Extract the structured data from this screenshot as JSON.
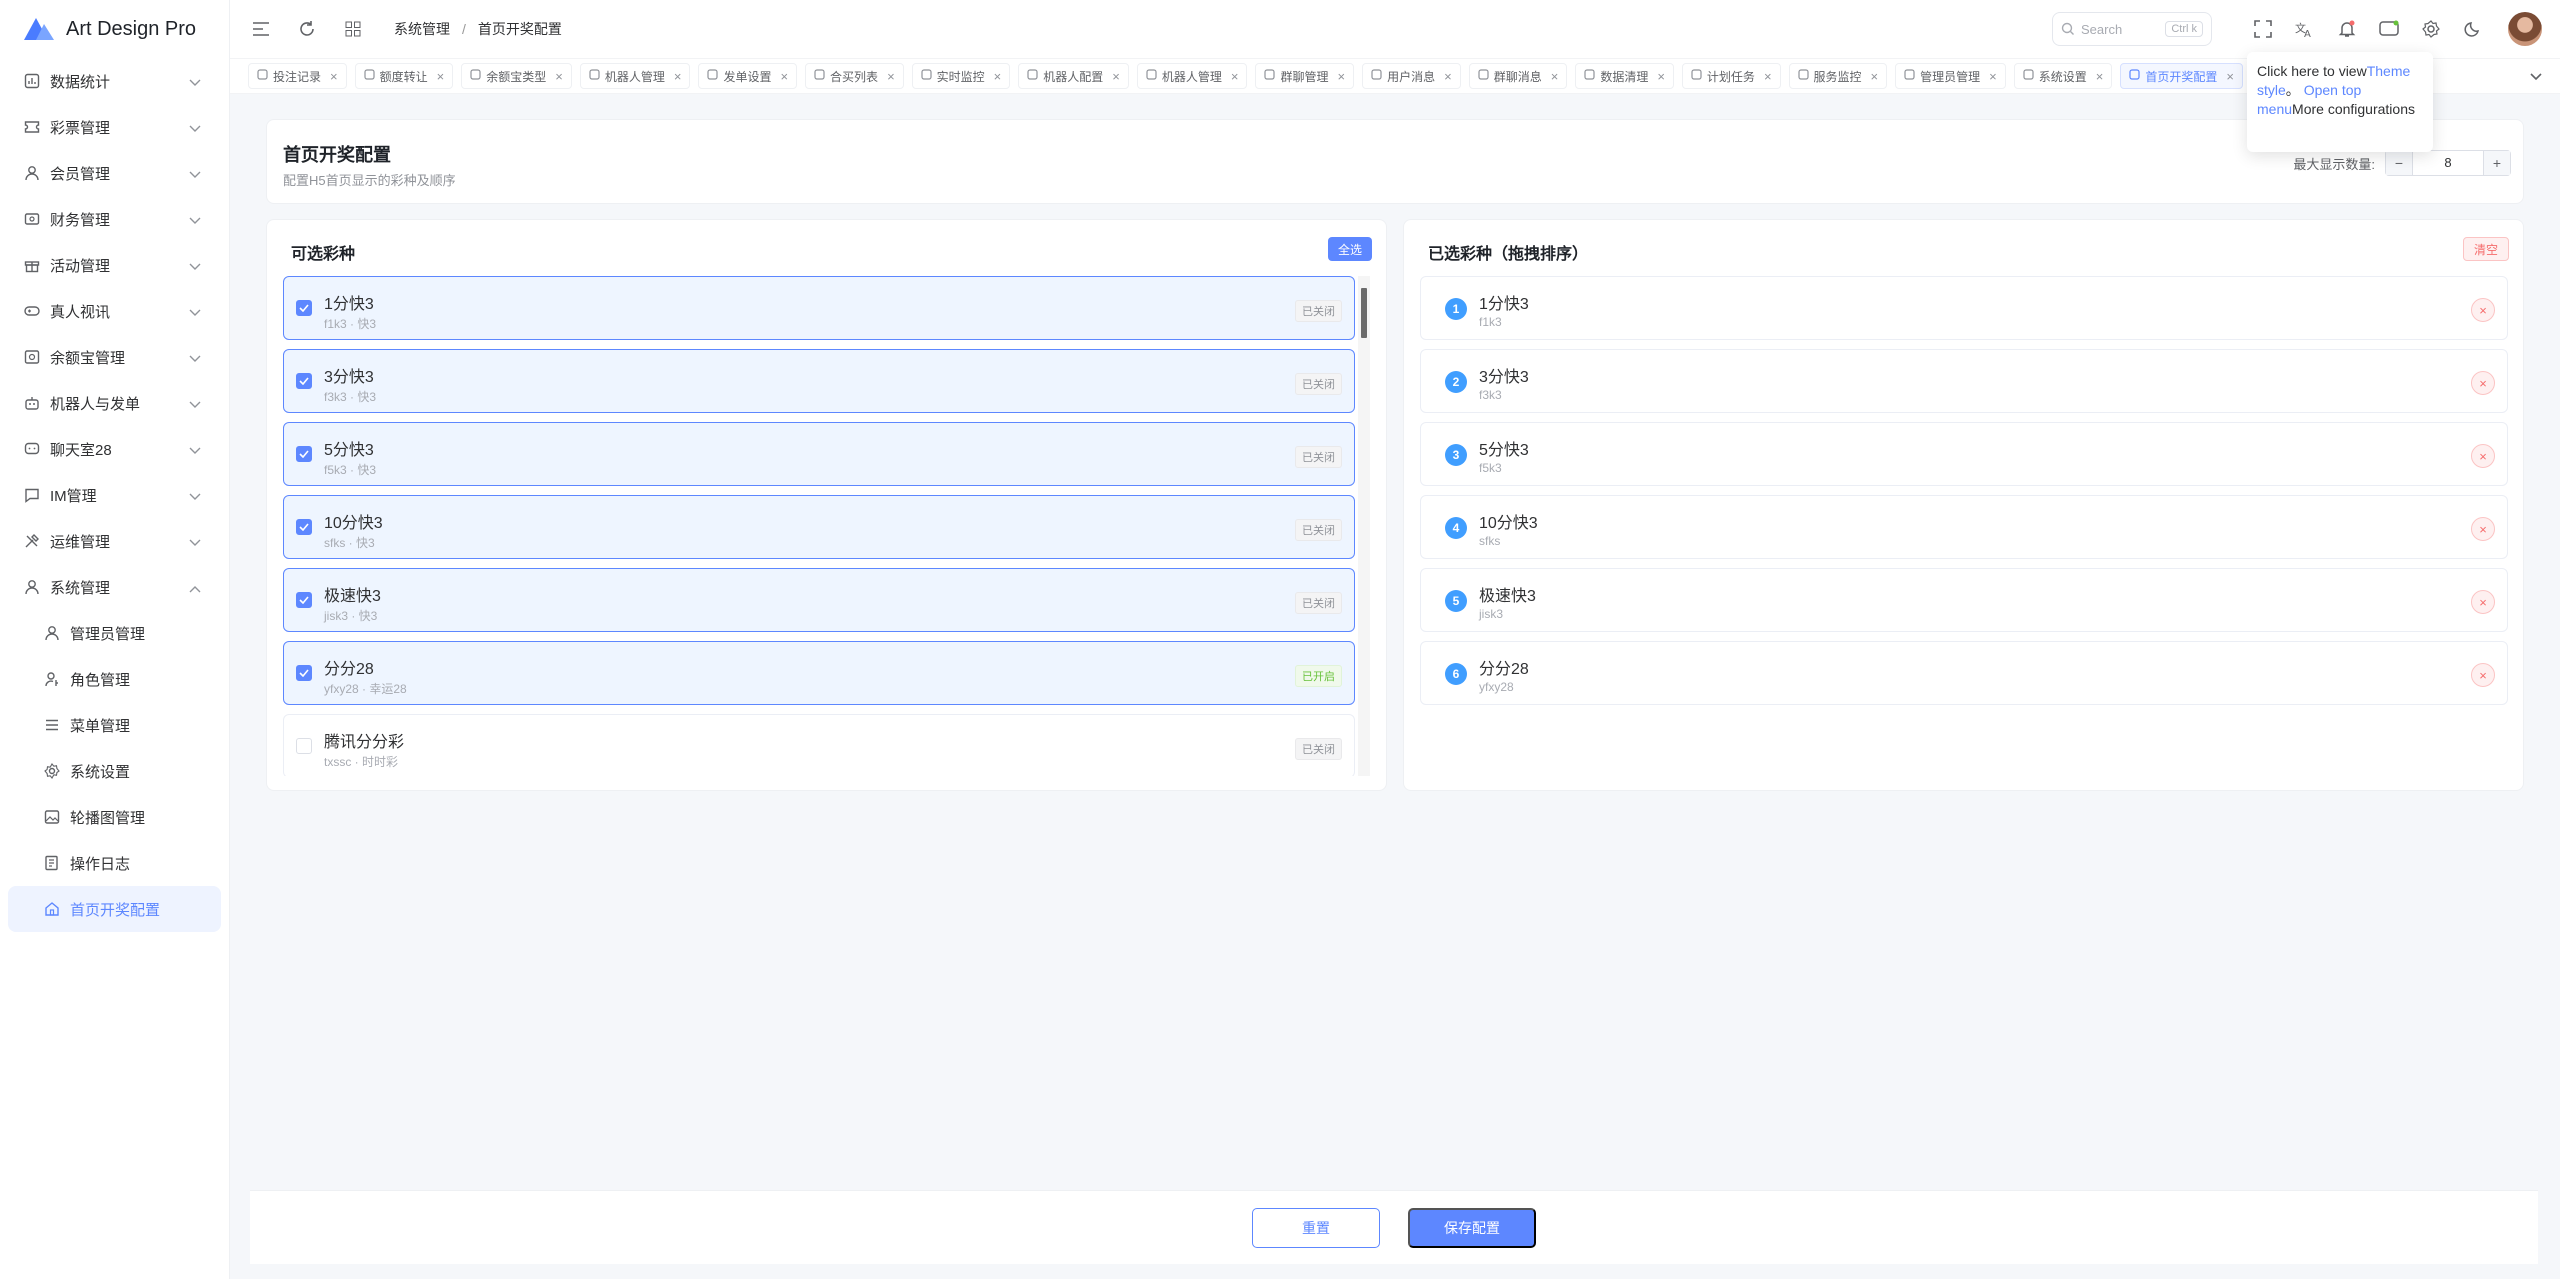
{
  "app": {
    "title": "Art Design Pro",
    "brand_color": "#5d87ff"
  },
  "sidebar": {
    "items": [
      {
        "label": "数据统计",
        "icon": "chart-icon"
      },
      {
        "label": "彩票管理",
        "icon": "ticket-icon"
      },
      {
        "label": "会员管理",
        "icon": "user-icon"
      },
      {
        "label": "财务管理",
        "icon": "wallet-icon"
      },
      {
        "label": "活动管理",
        "icon": "gift-icon"
      },
      {
        "label": "真人视讯",
        "icon": "gamepad-icon"
      },
      {
        "label": "余额宝管理",
        "icon": "safe-icon"
      },
      {
        "label": "机器人与发单",
        "icon": "robot-icon"
      },
      {
        "label": "聊天室28",
        "icon": "chat-icon"
      },
      {
        "label": "IM管理",
        "icon": "message-icon"
      },
      {
        "label": "运维管理",
        "icon": "tools-icon"
      },
      {
        "label": "系统管理",
        "icon": "user-icon"
      }
    ],
    "sub_items": [
      {
        "label": "管理员管理",
        "icon": "user-icon"
      },
      {
        "label": "角色管理",
        "icon": "user-key-icon"
      },
      {
        "label": "菜单管理",
        "icon": "list-icon"
      },
      {
        "label": "系统设置",
        "icon": "gear-icon"
      },
      {
        "label": "轮播图管理",
        "icon": "image-icon"
      },
      {
        "label": "操作日志",
        "icon": "log-icon"
      },
      {
        "label": "首页开奖配置",
        "icon": "home-icon"
      }
    ]
  },
  "header": {
    "breadcrumb": [
      "系统管理",
      "首页开奖配置"
    ],
    "search_placeholder": "Search",
    "search_shortcut": "Ctrl k"
  },
  "tabs": [
    {
      "label": "投注记录"
    },
    {
      "label": "额度转让"
    },
    {
      "label": "余额宝类型"
    },
    {
      "label": "机器人管理"
    },
    {
      "label": "发单设置"
    },
    {
      "label": "合买列表"
    },
    {
      "label": "实时监控"
    },
    {
      "label": "机器人配置"
    },
    {
      "label": "机器人管理"
    },
    {
      "label": "群聊管理"
    },
    {
      "label": "用户消息"
    },
    {
      "label": "群聊消息"
    },
    {
      "label": "数据清理"
    },
    {
      "label": "计划任务"
    },
    {
      "label": "服务监控"
    },
    {
      "label": "管理员管理"
    },
    {
      "label": "系统设置"
    },
    {
      "label": "首页开奖配置"
    }
  ],
  "tooltip": {
    "t1": "Click here to view",
    "h1": "Theme style",
    "t2": "。",
    "h2": "Open top menu",
    "t3": "More configurations"
  },
  "page": {
    "title": "首页开奖配置",
    "subtitle": "配置H5首页显示的彩种及顺序",
    "max_label": "最大显示数量:",
    "max_value": "8"
  },
  "left_panel": {
    "title": "可选彩种",
    "select_all": "全选",
    "items": [
      {
        "name": "1分快3",
        "code": "f1k3 · 快3",
        "status": "已关闭",
        "checked": true
      },
      {
        "name": "3分快3",
        "code": "f3k3 · 快3",
        "status": "已关闭",
        "checked": true
      },
      {
        "name": "5分快3",
        "code": "f5k3 · 快3",
        "status": "已关闭",
        "checked": true
      },
      {
        "name": "10分快3",
        "code": "sfks · 快3",
        "status": "已关闭",
        "checked": true
      },
      {
        "name": "极速快3",
        "code": "jisk3 · 快3",
        "status": "已关闭",
        "checked": true
      },
      {
        "name": "分分28",
        "code": "yfxy28 · 幸运28",
        "status": "已开启",
        "checked": true
      },
      {
        "name": "腾讯分分彩",
        "code": "txssc · 时时彩",
        "status": "已关闭",
        "checked": false
      }
    ]
  },
  "right_panel": {
    "title": "已选彩种（拖拽排序）",
    "clear": "清空",
    "items": [
      {
        "num": "1",
        "name": "1分快3",
        "code": "f1k3"
      },
      {
        "num": "2",
        "name": "3分快3",
        "code": "f3k3"
      },
      {
        "num": "3",
        "name": "5分快3",
        "code": "f5k3"
      },
      {
        "num": "4",
        "name": "10分快3",
        "code": "sfks"
      },
      {
        "num": "5",
        "name": "极速快3",
        "code": "jisk3"
      },
      {
        "num": "6",
        "name": "分分28",
        "code": "yfxy28"
      }
    ]
  },
  "footer": {
    "reset": "重置",
    "save": "保存配置"
  }
}
